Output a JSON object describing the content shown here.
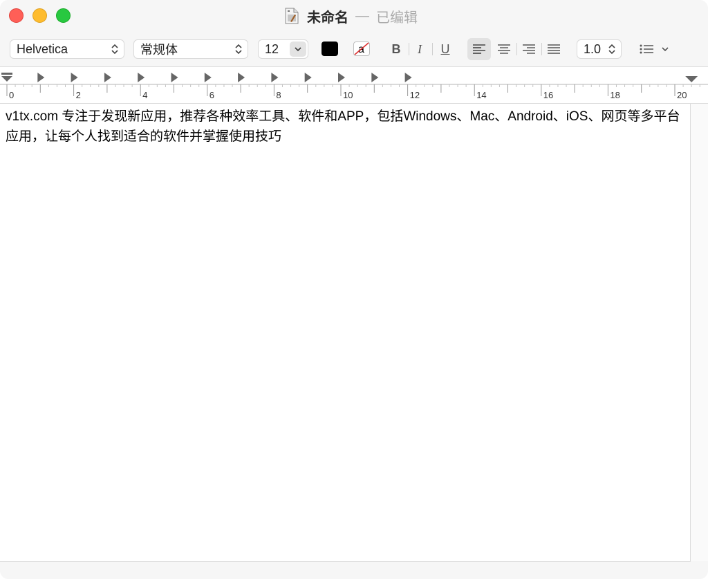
{
  "window": {
    "title": "未命名",
    "separator": "—",
    "status": "已编辑"
  },
  "toolbar": {
    "font_family": "Helvetica",
    "font_style": "常规体",
    "font_size": "12",
    "text_color": "#000000",
    "bold_label": "B",
    "italic_label": "I",
    "underline_label": "U",
    "line_spacing": "1.0",
    "highlight_label": "a"
  },
  "ruler": {
    "labels": [
      "0",
      "2",
      "4",
      "6",
      "8",
      "10",
      "12",
      "14",
      "16",
      "18",
      "20"
    ]
  },
  "document": {
    "text": "v1tx.com 专注于发现新应用，推荐各种效率工具、软件和APP，包括Windows、Mac、Android、iOS、网页等多平台应用，让每个人找到适合的软件并掌握使用技巧"
  },
  "colors": {
    "close": "#ff5f57",
    "minimize": "#febc2e",
    "zoom": "#28c840"
  }
}
